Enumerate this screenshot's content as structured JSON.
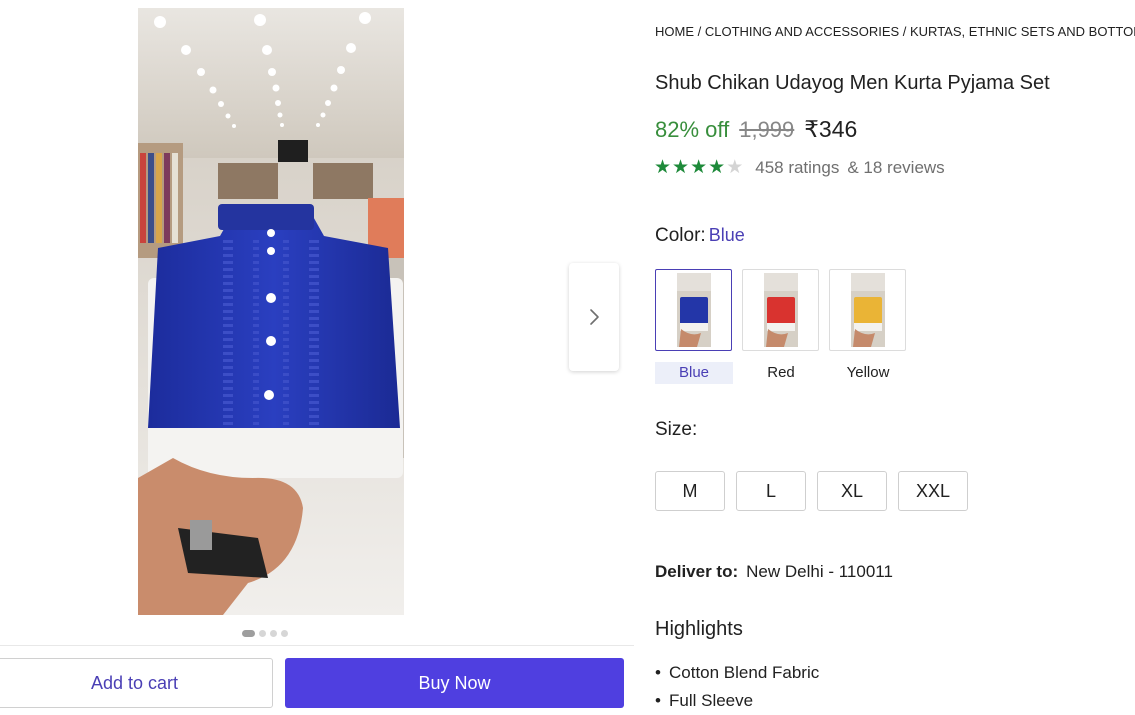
{
  "breadcrumb": "HOME / CLOTHING AND ACCESSORIES / KURTAS, ETHNIC SETS AND BOTTOMS",
  "product": {
    "title": "Shub Chikan Udayog Men Kurta Pyjama Set",
    "discount": "82% off",
    "mrp": "1,999",
    "price": "₹346",
    "rating_value": 4,
    "rating_max": 5,
    "ratings_text": "458 ratings",
    "reviews_text": "& 18 reviews"
  },
  "gallery": {
    "image_count": 4,
    "active_index": 0,
    "next_icon": "chevron-right-icon"
  },
  "color": {
    "label": "Color:",
    "selected": "Blue",
    "options": [
      {
        "name": "Blue",
        "hex": "#2336a8"
      },
      {
        "name": "Red",
        "hex": "#d9332f"
      },
      {
        "name": "Yellow",
        "hex": "#eab436"
      }
    ]
  },
  "size": {
    "label": "Size:",
    "options": [
      "M",
      "L",
      "XL",
      "XXL"
    ]
  },
  "delivery": {
    "label": "Deliver to:",
    "place": "New Delhi - 110011"
  },
  "highlights": {
    "title": "Highlights",
    "items": [
      "Cotton Blend Fabric",
      "Full Sleeve"
    ]
  },
  "actions": {
    "add_to_cart": "Add to cart",
    "buy_now": "Buy Now"
  },
  "colors": {
    "accent": "#4a3fb5",
    "buy_button": "#4f3fe0",
    "discount_green": "#388e3c",
    "star_green": "#1e8a3a"
  }
}
